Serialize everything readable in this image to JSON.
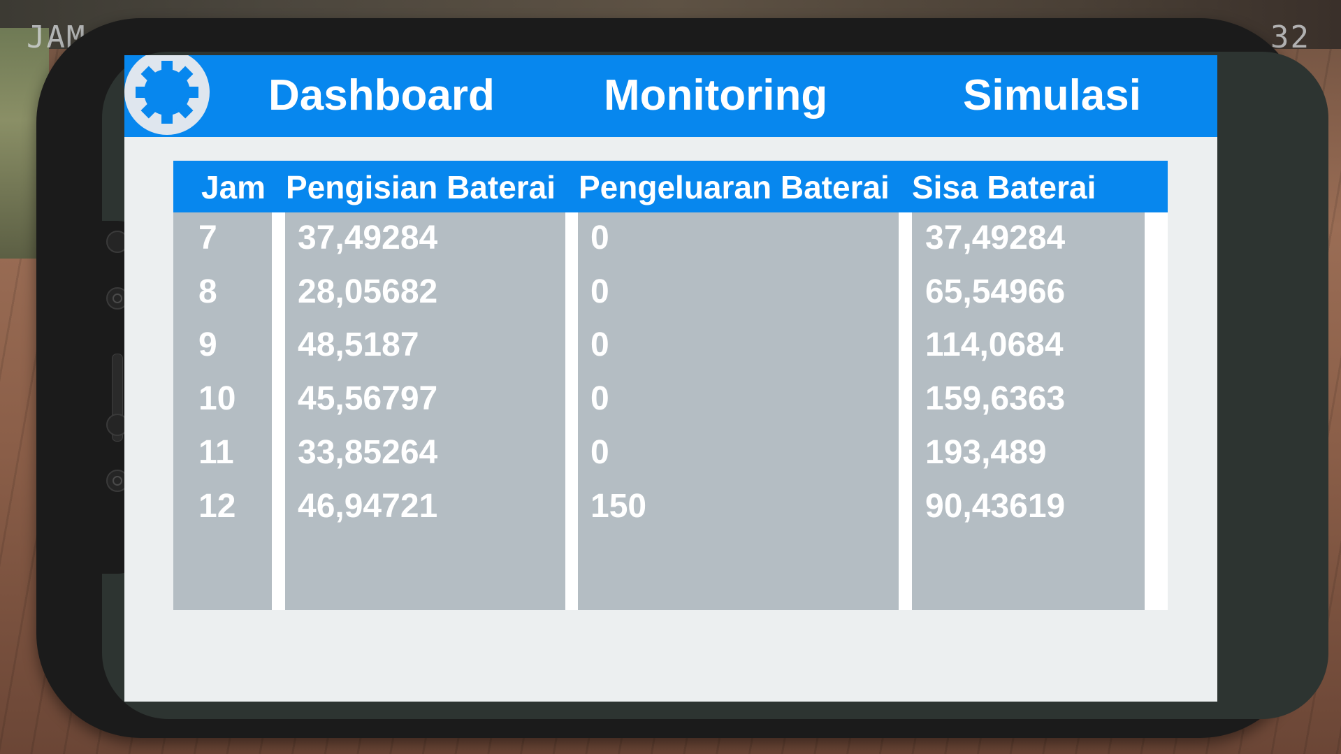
{
  "hud": {
    "left_text": "JAM",
    "right_text": "32"
  },
  "nav": {
    "items": [
      "Dashboard",
      "Monitoring",
      "Simulasi"
    ]
  },
  "table": {
    "headers": [
      "Jam",
      "Pengisian Baterai",
      "Pengeluaran Baterai",
      "Sisa Baterai"
    ],
    "rows": [
      [
        "7",
        "37,49284",
        "0",
        "37,49284"
      ],
      [
        "8",
        "28,05682",
        "0",
        "65,54966"
      ],
      [
        "9",
        "48,5187",
        "0",
        "114,0684"
      ],
      [
        "10",
        "45,56797",
        "0",
        "159,6363"
      ],
      [
        "11",
        "33,85264",
        "0",
        "193,489"
      ],
      [
        "12",
        "46,94721",
        "150",
        "90,43619"
      ]
    ]
  },
  "colors": {
    "accent": "#0787ee",
    "cell_bg": "#b4bdc3",
    "screen_bg": "#eceff0",
    "phone_body": "#1b1b1b"
  },
  "icons": {
    "settings": "gear-icon"
  }
}
